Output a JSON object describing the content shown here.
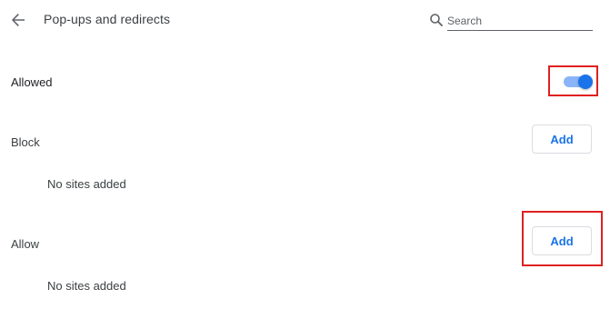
{
  "header": {
    "title": "Pop-ups and redirects",
    "back_icon": "arrow-back-icon",
    "search": {
      "placeholder": "Search",
      "value": "",
      "icon": "search-icon"
    }
  },
  "allowed_row": {
    "label": "Allowed",
    "toggle_on": true,
    "toggle_color": "#1a73e8"
  },
  "block_section": {
    "label": "Block",
    "add_label": "Add",
    "empty_text": "No sites added"
  },
  "allow_section": {
    "label": "Allow",
    "add_label": "Add",
    "empty_text": "No sites added"
  },
  "colors": {
    "accent": "#1a73e8",
    "highlight": "#e02020"
  }
}
